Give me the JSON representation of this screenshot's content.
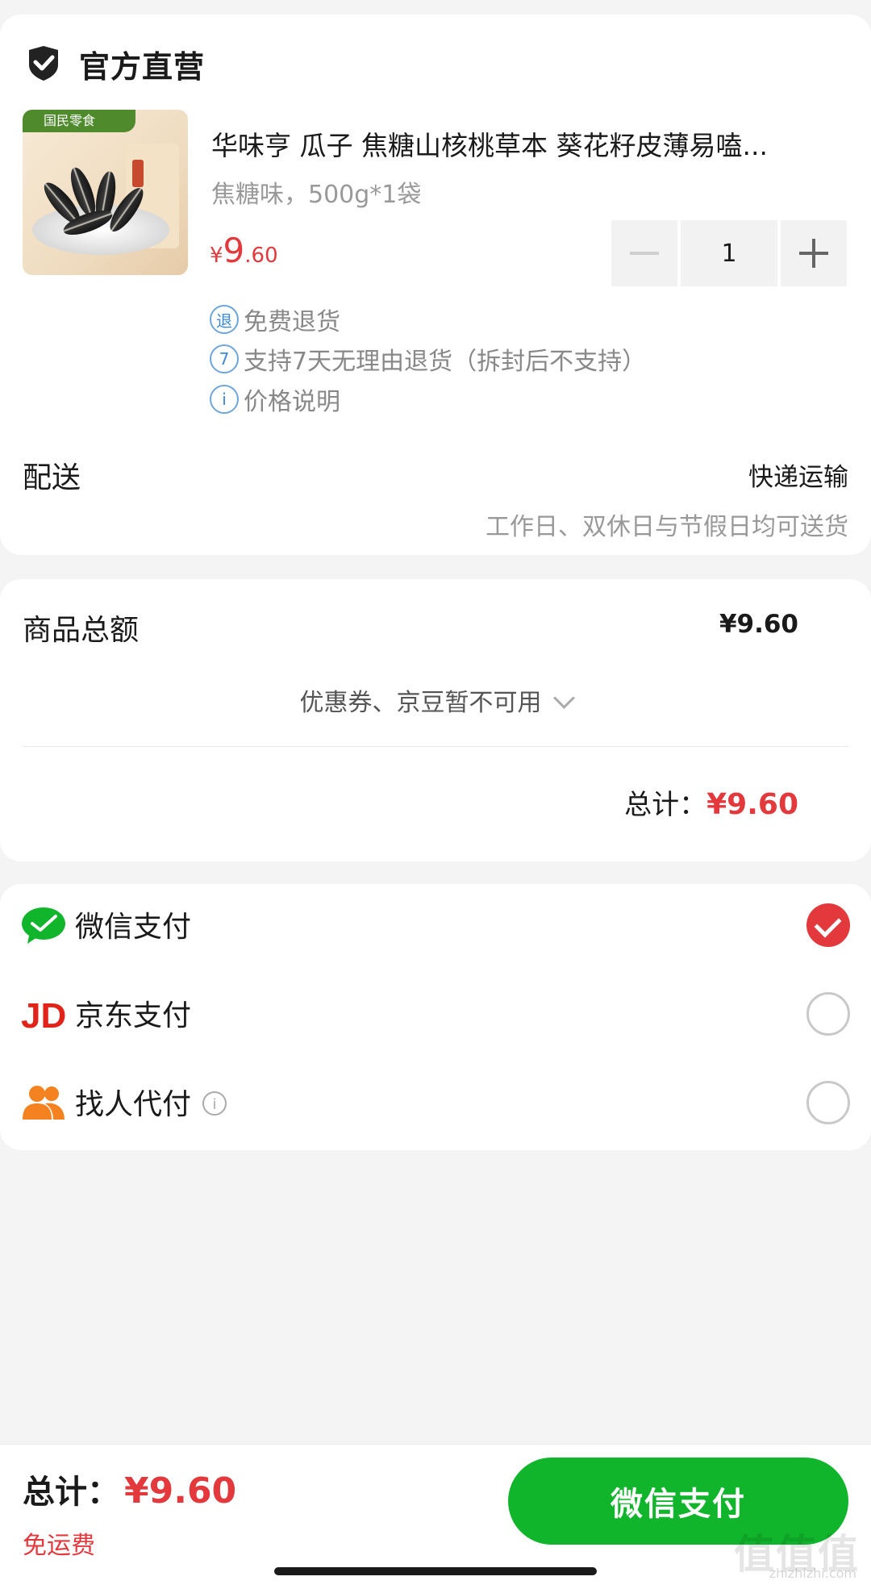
{
  "store": {
    "title": "官方直营",
    "icon": "shield-check-icon"
  },
  "product": {
    "title": "华味亨 瓜子 焦糖山核桃草本 葵花籽皮薄易嗑...",
    "spec": "焦糖味，500g*1袋",
    "price_symbol": "¥",
    "price_int": "9",
    "price_dec": ".60",
    "quantity": "1",
    "image_brand": "国民零食"
  },
  "services": [
    {
      "icon_text": "退",
      "label": "免费退货"
    },
    {
      "icon_text": "7",
      "label": "支持7天无理由退货（拆封后不支持）"
    },
    {
      "icon_text": "i",
      "label": "价格说明"
    }
  ],
  "shipping": {
    "label": "配送",
    "method": "快递运输",
    "note": "工作日、双休日与节假日均可送货"
  },
  "summary": {
    "goods_label": "商品总额",
    "goods_amount": "¥9.60",
    "coupon_text": "优惠券、京豆暂不可用",
    "total_label": "总计：",
    "total_amount": "¥9.60"
  },
  "payments": [
    {
      "label": "微信支付",
      "selected": true,
      "icon": "wechat-icon"
    },
    {
      "label": "京东支付",
      "selected": false,
      "icon": "jd-icon"
    },
    {
      "label": "找人代付",
      "selected": false,
      "icon": "friends-icon"
    }
  ],
  "footer": {
    "total_label": "总计：",
    "total_amount": "¥9.60",
    "free_shipping": "免运费",
    "pay_button": "微信支付",
    "watermark": "值值值",
    "watermark_url": "zhizhizhi.com"
  },
  "colors": {
    "accent_red": "#e3393c",
    "wechat_green": "#10b52c",
    "link_blue": "#3b8ad8"
  }
}
